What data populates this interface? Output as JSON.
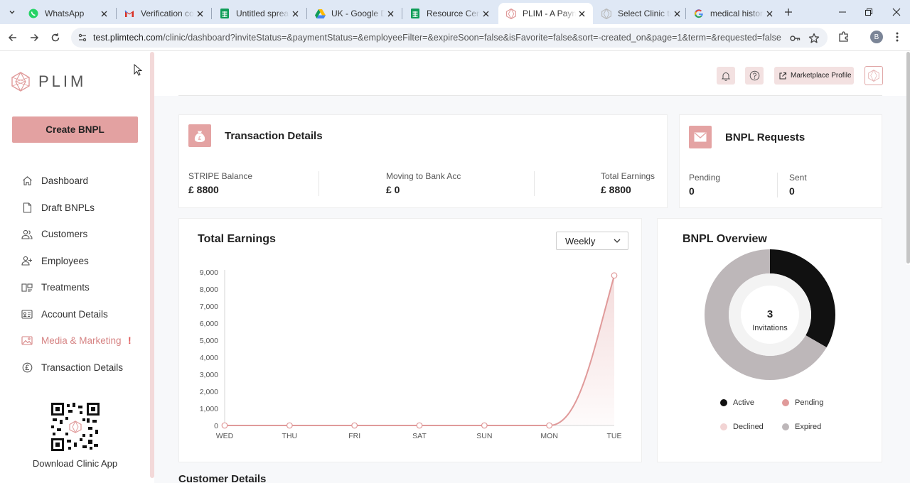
{
  "browser": {
    "tabs": [
      {
        "title": "WhatsApp",
        "icon": "whatsapp-icon",
        "active": false
      },
      {
        "title": "Verification code",
        "icon": "gmail-icon",
        "active": false
      },
      {
        "title": "Untitled spreadsheet",
        "icon": "sheets-icon",
        "active": false
      },
      {
        "title": "UK - Google Drive",
        "icon": "drive-icon",
        "active": false
      },
      {
        "title": "Resource Centre",
        "icon": "sheets-icon",
        "active": false
      },
      {
        "title": "PLIM - A Payment",
        "icon": "plim-icon",
        "active": true
      },
      {
        "title": "Select Clinic to continue",
        "icon": "plim-gray-icon",
        "active": false
      },
      {
        "title": "medical history",
        "icon": "google-icon",
        "active": false
      }
    ],
    "url_host": "test.plimtech.com",
    "url_path": "/clinic/dashboard?inviteStatus=&paymentStatus=&employeeFilter=&expireSoon=false&isFavorite=false&sort=-created_on&page=1&term=&requested=false",
    "profile_initial": "B"
  },
  "sidebar": {
    "logo_text": "PLIM",
    "create_button": "Create BNPL",
    "items": [
      {
        "label": "Dashboard",
        "icon": "home-icon"
      },
      {
        "label": "Draft BNPLs",
        "icon": "document-icon"
      },
      {
        "label": "Customers",
        "icon": "users-icon"
      },
      {
        "label": "Employees",
        "icon": "add-user-icon"
      },
      {
        "label": "Treatments",
        "icon": "treatments-icon"
      },
      {
        "label": "Account Details",
        "icon": "id-card-icon"
      },
      {
        "label": "Media & Marketing",
        "icon": "image-icon",
        "alert": "!"
      },
      {
        "label": "Transaction Details",
        "icon": "pound-icon"
      }
    ],
    "download_label": "Download Clinic App"
  },
  "topbar": {
    "marketplace_label": "Marketplace Profile"
  },
  "transaction_details": {
    "title": "Transaction Details",
    "stats": [
      {
        "label": "STRIPE Balance",
        "value": "£ 8800"
      },
      {
        "label": "Moving to Bank Acc",
        "value": "£ 0"
      },
      {
        "label": "Total Earnings",
        "value": "£ 8800"
      }
    ]
  },
  "bnpl_requests": {
    "title": "BNPL Requests",
    "stats": [
      {
        "label": "Pending",
        "value": "0"
      },
      {
        "label": "Sent",
        "value": "0"
      }
    ]
  },
  "total_earnings": {
    "title": "Total Earnings",
    "period": "Weekly"
  },
  "bnpl_overview": {
    "title": "BNPL Overview",
    "center_value": "3",
    "center_label": "Invitations",
    "legend": [
      {
        "label": "Active",
        "color": "#111111"
      },
      {
        "label": "Pending",
        "color": "#e09a9a"
      },
      {
        "label": "Declined",
        "color": "#f2d4d4"
      },
      {
        "label": "Expired",
        "color": "#bdb7b9"
      }
    ]
  },
  "customer_details": {
    "title": "Customer Details"
  },
  "chart_data": [
    {
      "type": "area",
      "title": "Total Earnings",
      "categories": [
        "WED",
        "THU",
        "FRI",
        "SAT",
        "SUN",
        "MON",
        "TUE"
      ],
      "values": [
        0,
        0,
        0,
        0,
        0,
        0,
        8800
      ],
      "y_ticks": [
        "0",
        "1,000",
        "2,000",
        "3,000",
        "4,000",
        "5,000",
        "6,000",
        "7,000",
        "8,000",
        "9,000"
      ],
      "ylim": [
        0,
        9000
      ],
      "color": "#e09a9a"
    },
    {
      "type": "pie",
      "title": "BNPL Overview",
      "labels": [
        "Active",
        "Pending",
        "Declined",
        "Expired"
      ],
      "values": [
        1,
        0,
        0,
        2
      ],
      "colors": [
        "#111111",
        "#e09a9a",
        "#f2d4d4",
        "#bdb7b9"
      ]
    }
  ]
}
